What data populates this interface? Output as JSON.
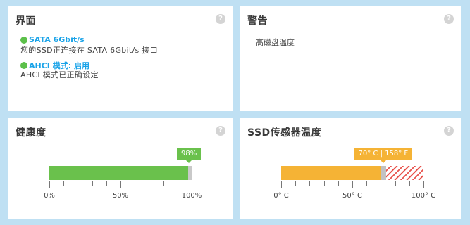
{
  "interface": {
    "title": "界面",
    "help": "?",
    "items": [
      {
        "status": "SATA 6Gbit/s",
        "description": "您的SSD正连接在 SATA 6Gbit/s 接口"
      },
      {
        "status": "AHCI 模式: 启用",
        "description": "AHCI 模式已正确设定"
      }
    ]
  },
  "warning": {
    "title": "警告",
    "help": "?",
    "message": "高磁盘温度"
  },
  "health": {
    "title": "健康度",
    "help": "?",
    "value_label": "98%",
    "value_percent": 98,
    "axis_labels": [
      "0%",
      "50%",
      "100%"
    ],
    "colors": {
      "fill": "#6ac14c",
      "remaining": "#c9c9c9"
    }
  },
  "temperature": {
    "title": "SSD传感器温度",
    "help": "?",
    "value_label": "70° C | 158° F",
    "value_celsius": 70,
    "axis_labels": [
      "0° C",
      "50° C",
      "100° C"
    ],
    "colors": {
      "fill": "#f5b335",
      "danger_hatch": "#e8524c"
    }
  }
}
